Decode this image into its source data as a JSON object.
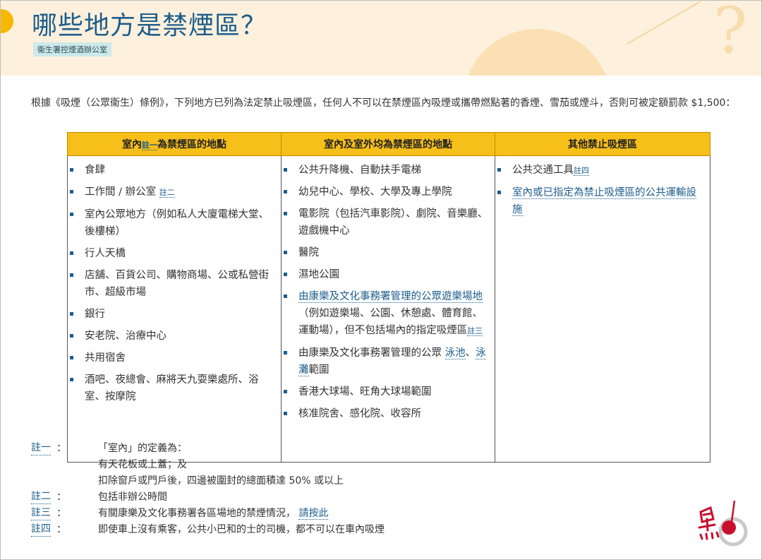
{
  "page": {
    "title": "哪些地方是禁煙區？",
    "source": "衞生署控煙酒辦公室",
    "intro": "根據《吸煙（公眾衞生）條例》，下列地方已列為法定禁止吸煙區，任何人不可以在禁煙區內吸煙或攜帶燃點著的香煙、雪茄或煙斗，否則可被定額罰款 $1,500："
  },
  "table": {
    "headers": {
      "col1_prefix": "室內",
      "col1_ref": "註一",
      "col1_suffix": "為禁煙區的地點",
      "col2": "室內及室外均為禁煙區的地點",
      "col3": "其他禁止吸煙區"
    },
    "col1": {
      "i1": "食肆",
      "i2": "工作間 / 辦公室",
      "i2_ref": "註二",
      "i3": "室內公眾地方（例如私人大廈電梯大堂、後樓梯）",
      "i4": "行人天橋",
      "i5": "店舖、百貨公司、購物商場、公或私營街市、超級市場",
      "i6": "銀行",
      "i7": "安老院、治療中心",
      "i8": "共用宿舍",
      "i9": "酒吧、夜總會、麻將天九耍樂處所、浴室、按摩院"
    },
    "col2": {
      "i1": "公共升降機、自動扶手電梯",
      "i2": "幼兒中心、學校、大學及專上學院",
      "i3": "電影院（包括汽車影院）、劇院、音樂廳、遊戲機中心",
      "i4": "醫院",
      "i5": "濕地公園",
      "i6_link": "由康樂及文化事務署管理的公眾遊樂場地",
      "i6_text": "（例如遊樂場、公園、休憩處、體育館、運動場），但不包括場內的指定吸煙區",
      "i6_ref": "註三",
      "i7_text": "由康樂及文化事務署管理的公眾",
      "i7_link1": "泳池",
      "i7_sep": "、",
      "i7_link2": "泳灘",
      "i7_suffix": "範圍",
      "i8": "香港大球場、旺角大球場範圍",
      "i9": "核准院舍、感化院、收容所"
    },
    "col3": {
      "i1": "公共交通工具",
      "i1_ref": "註四",
      "i2_link": "室內或已指定為禁止吸煙區的公共運輸設施"
    }
  },
  "notes": {
    "n1_label": "註一",
    "n1_line1": "「室內」的定義為：",
    "n1_line2": "有天花板或上蓋；及",
    "n1_line3": "扣除窗戶或門戶後，四邊被圍封的總面積達 50% 或以上",
    "n2_label": "註二",
    "n2_text": "包括非辦公時間",
    "n3_label": "註三",
    "n3_text": "有關康樂及文化事務署各區場地的禁煙情況，",
    "n3_link": "請按此",
    "n4_label": "註四",
    "n4_text": "即使車上沒有乘客，公共小巴和的士的司機，都不可以在車內吸煙",
    "colon": "："
  },
  "logo": {
    "icon": "brand-logo-icon",
    "color": "#c8102e"
  },
  "colors": {
    "accent": "#1c5d8c",
    "header_yellow": "#f7bf19",
    "banner": "#fdf0dc",
    "badge": "#cde9e9"
  }
}
